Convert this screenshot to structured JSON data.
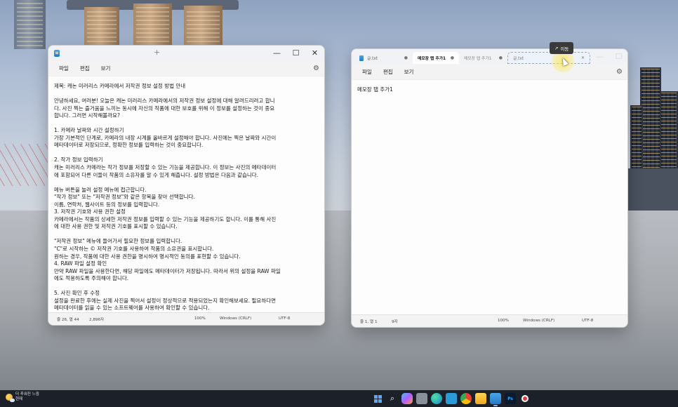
{
  "left_window": {
    "menu": {
      "file": "파일",
      "edit": "편집",
      "view": "보기"
    },
    "controls": {
      "minimize": "—",
      "maximize": "☐",
      "close": "✕"
    },
    "new_tab": "+",
    "content": "제목: 캐논 미러리스 카메라에서 저작권 정보 설정 방법 안내\n\n안녕하세요, 여러분! 오늘은 캐논 미러리스 카메라에서의 저작권 정보 설정에 대해 알려드리려고 합니\n다. 사진 찍는 즐거움을 느끼는 동시에 자신의 작품에 대한 보호를 위해 이 정보를 설정하는 것이 중요\n합니다. 그러면 시작해볼까요?\n\n1. 카메라 날짜와 시간 설정하기\n가장 기본적인 단계로, 카메라의 내장 시계를 올바르게 설정해야 합니다. 사진에는 찍은 날짜와 시간이\n메타데이터로 저장되므로, 정확한 정보를 입력하는 것이 중요합니다.\n\n2. 작가 정보 입력하기\n캐논 미러리스 카메라는 작가 정보를 저장할 수 있는 기능을 제공합니다. 이 정보는 사진의 메타데이터\n에 포함되어 다른 이들이 작품의 소유자를 알 수 있게 해줍니다. 설정 방법은 다음과 같습니다.\n\n메뉴 버튼을 눌러 설정 메뉴에 접근합니다.\n\"작가 정보\" 또는 \"저작권 정보\"와 같은 항목을 찾아 선택합니다.\n이름, 연락처, 웹사이트 등의 정보를 입력합니다.\n3. 저작권 기호와 사용 권한 설정\n카메라에서는 작품의 상세한 저작권 정보를 입력할 수 있는 기능을 제공하기도 합니다. 이를 통해 사진\n에 대한 사용 권한 및 저작권 기호를 표시할 수 있습니다.\n\n\"저작권 정보\" 메뉴에 들어가서 필요한 정보를 입력합니다.\n\"C\"로 시작하는 © 저작권 기호를 사용하여 작품의 소유권을 표시합니다.\n원하는 경우, 작품에 대한 사용 권한을 명시하여 명시적인 동의를 표현할 수 있습니다.\n4. RAW 파일 설정 확인\n만약 RAW 파일을 사용한다면, 해당 파일에도 메타데이터가 저장됩니다. 따라서 위의 설정을 RAW 파일\n에도 적용하도록 주의해야 합니다.\n\n5. 사진 확인 후 수정\n설정을 완료한 후에는 실제 사진을 찍어서 설정이 정상적으로 적용되었는지 확인해보세요. 필요하다면\n메타데이터를 읽을 수 있는 소프트웨어를 사용하여 확인할 수 있습니다.",
    "status": {
      "position": "줄 26, 열 44",
      "chars": "2,896자",
      "zoom": "100%",
      "line_ending": "Windows (CRLF)",
      "encoding": "UTF-8"
    }
  },
  "right_window": {
    "tabs": [
      {
        "label": "글.txt",
        "close": "●"
      },
      {
        "label": "메모장 탭 추가1",
        "close": "●"
      },
      {
        "label": "메모장 탭 추가1",
        "close": "●"
      },
      {
        "label": "글.txt",
        "close": "✕"
      }
    ],
    "menu": {
      "file": "파일",
      "edit": "편집",
      "view": "보기"
    },
    "controls": {
      "minimize": "—",
      "maximize": "☐",
      "close": "✕"
    },
    "content": "메모장 탭 추가1",
    "status": {
      "position": "줄 1, 열 1",
      "chars": "9자",
      "zoom": "100%",
      "line_ending": "Windows (CRLF)",
      "encoding": "UTF-8"
    }
  },
  "drag_tooltip": {
    "arrow": "↗",
    "label": "이동"
  },
  "taskbar": {
    "weather_line1": "더 추워진 느낌",
    "weather_line2": "현재",
    "icons": [
      "windows-start",
      "search",
      "copilot",
      "file-explorer-gallery",
      "edge",
      "game",
      "chrome",
      "file-explorer",
      "notepad",
      "photoshop",
      "record"
    ]
  },
  "colors": {
    "accent": "#3b82d9",
    "taskbar": "#1c2029",
    "tooltip": "#3a3a3a"
  }
}
